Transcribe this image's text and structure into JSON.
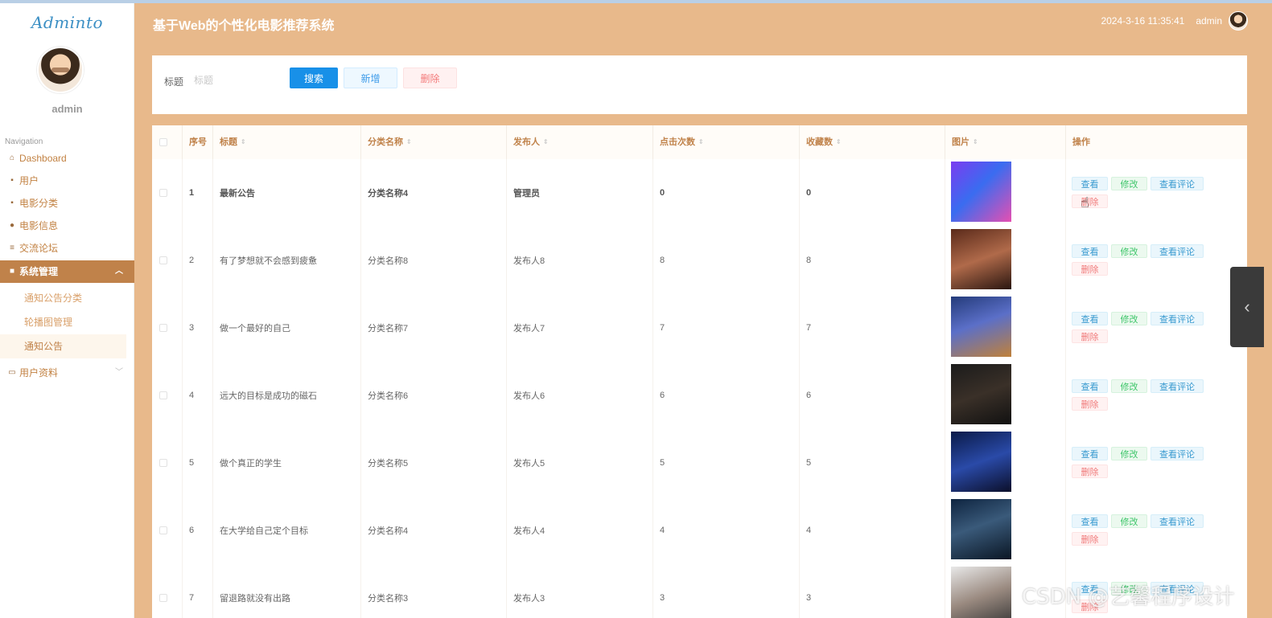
{
  "sidebar": {
    "logo": "Adminto",
    "username": "admin",
    "nav_title": "Navigation",
    "items": [
      {
        "label": "Dashboard",
        "icon": "home-icon"
      },
      {
        "label": "用户",
        "icon": "grid-icon"
      },
      {
        "label": "电影分类",
        "icon": "grid-icon"
      },
      {
        "label": "电影信息",
        "icon": "user-icon"
      },
      {
        "label": "交流论坛",
        "icon": "list-icon"
      },
      {
        "label": "系统管理",
        "icon": "book-icon",
        "expanded": true
      },
      {
        "label": "用户资料",
        "icon": "card-icon"
      }
    ],
    "subitems": [
      {
        "label": "通知公告分类"
      },
      {
        "label": "轮播图管理"
      },
      {
        "label": "通知公告",
        "active": true
      }
    ]
  },
  "header": {
    "title": "基于Web的个性化电影推荐系统",
    "datetime": "2024-3-16 11:35:41",
    "user": "admin"
  },
  "search": {
    "label": "标题",
    "placeholder": "标题",
    "search_btn": "搜索",
    "add_btn": "新增",
    "delete_btn": "删除"
  },
  "table": {
    "columns": [
      "序号",
      "标题",
      "分类名称",
      "发布人",
      "点击次数",
      "收藏数",
      "图片",
      "操作"
    ],
    "actions": {
      "view": "查看",
      "edit": "修改",
      "comments": "查看评论",
      "delete": "删除"
    },
    "rows": [
      {
        "no": "1",
        "title": "最新公告",
        "category": "分类名称4",
        "publisher": "管理员",
        "clicks": "0",
        "favorites": "0"
      },
      {
        "no": "2",
        "title": "有了梦想就不会感到疲惫",
        "category": "分类名称8",
        "publisher": "发布人8",
        "clicks": "8",
        "favorites": "8"
      },
      {
        "no": "3",
        "title": "做一个最好的自己",
        "category": "分类名称7",
        "publisher": "发布人7",
        "clicks": "7",
        "favorites": "7"
      },
      {
        "no": "4",
        "title": "远大的目标是成功的磁石",
        "category": "分类名称6",
        "publisher": "发布人6",
        "clicks": "6",
        "favorites": "6"
      },
      {
        "no": "5",
        "title": "做个真正的学生",
        "category": "分类名称5",
        "publisher": "发布人5",
        "clicks": "5",
        "favorites": "5"
      },
      {
        "no": "6",
        "title": "在大学给自己定个目标",
        "category": "分类名称4",
        "publisher": "发布人4",
        "clicks": "4",
        "favorites": "4"
      },
      {
        "no": "7",
        "title": "留退路就没有出路",
        "category": "分类名称3",
        "publisher": "发布人3",
        "clicks": "3",
        "favorites": "3"
      }
    ]
  },
  "watermark": "CSDN @艺馨程序设计",
  "colors": {
    "header_bg": "#e8b98b",
    "sidebar_active": "#c0824a",
    "primary": "#1890e8",
    "accent_text": "#c0824a"
  }
}
